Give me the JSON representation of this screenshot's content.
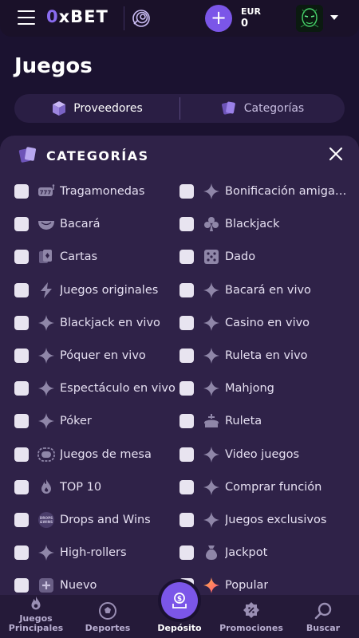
{
  "header": {
    "logo_zero": "0",
    "logo_rest": "xBET",
    "currency": "EUR",
    "balance": "0",
    "plus_label": "+"
  },
  "page": {
    "title": "Juegos",
    "tabs": [
      {
        "label": "Proveedores",
        "icon": "cube-icon"
      },
      {
        "label": "Categorías",
        "icon": "cards-icon"
      }
    ]
  },
  "panel": {
    "title": "CATEGORÍAS",
    "categories": [
      {
        "label": "Tragamonedas",
        "icon": "slot-icon",
        "checked": false
      },
      {
        "label": "Bonificación amigable",
        "icon": "sparkle-icon",
        "checked": false
      },
      {
        "label": "Bacará",
        "icon": "baccarat-icon",
        "checked": false
      },
      {
        "label": "Blackjack",
        "icon": "club-icon",
        "checked": false
      },
      {
        "label": "Cartas",
        "icon": "cards-icon",
        "checked": false
      },
      {
        "label": "Dado",
        "icon": "dice-icon",
        "checked": false
      },
      {
        "label": "Juegos originales",
        "icon": "bolt-icon",
        "checked": false
      },
      {
        "label": "Bacará en vivo",
        "icon": "sparkle-icon",
        "checked": false
      },
      {
        "label": "Blackjack en vivo",
        "icon": "sparkle-icon",
        "checked": false
      },
      {
        "label": "Casino en vivo",
        "icon": "sparkle-icon",
        "checked": false
      },
      {
        "label": "Póquer en vivo",
        "icon": "sparkle-icon",
        "checked": false
      },
      {
        "label": "Ruleta en vivo",
        "icon": "sparkle-icon",
        "checked": false
      },
      {
        "label": "Espectáculo en vivo",
        "icon": "sparkle-icon",
        "checked": false
      },
      {
        "label": "Mahjong",
        "icon": "sparkle-icon",
        "checked": false
      },
      {
        "label": "Póker",
        "icon": "sparkle-icon",
        "checked": false
      },
      {
        "label": "Ruleta",
        "icon": "roulette-icon",
        "checked": false
      },
      {
        "label": "Juegos de mesa",
        "icon": "table-icon",
        "checked": false
      },
      {
        "label": "Video juegos",
        "icon": "sparkle-icon",
        "checked": false
      },
      {
        "label": "TOP 10",
        "icon": "fire-icon",
        "checked": false
      },
      {
        "label": "Comprar función",
        "icon": "sparkle-icon",
        "checked": false
      },
      {
        "label": "Drops and Wins",
        "icon": "drops-wins-icon",
        "checked": false
      },
      {
        "label": "Juegos exclusivos",
        "icon": "sparkle-icon",
        "checked": false
      },
      {
        "label": "High-rollers",
        "icon": "sparkle-icon",
        "checked": false
      },
      {
        "label": "Jackpot",
        "icon": "moneybag-icon",
        "checked": false
      },
      {
        "label": "Nuevo",
        "icon": "new-icon",
        "checked": false
      },
      {
        "label": "Popular",
        "icon": "sparkle-color-icon",
        "checked": false
      }
    ]
  },
  "bottom_nav": {
    "items": [
      {
        "label": "Juegos Principales",
        "icon": "flame-icon"
      },
      {
        "label": "Deportes",
        "icon": "soccer-ball-icon"
      },
      {
        "label": "Depósito",
        "icon": "deposit-icon"
      },
      {
        "label": "Promociones",
        "icon": "promo-icon"
      },
      {
        "label": "Buscar",
        "icon": "search-icon"
      }
    ]
  },
  "colors": {
    "accent": "#7b56e8",
    "background": "#1b1230",
    "panel": "#2f2248"
  }
}
